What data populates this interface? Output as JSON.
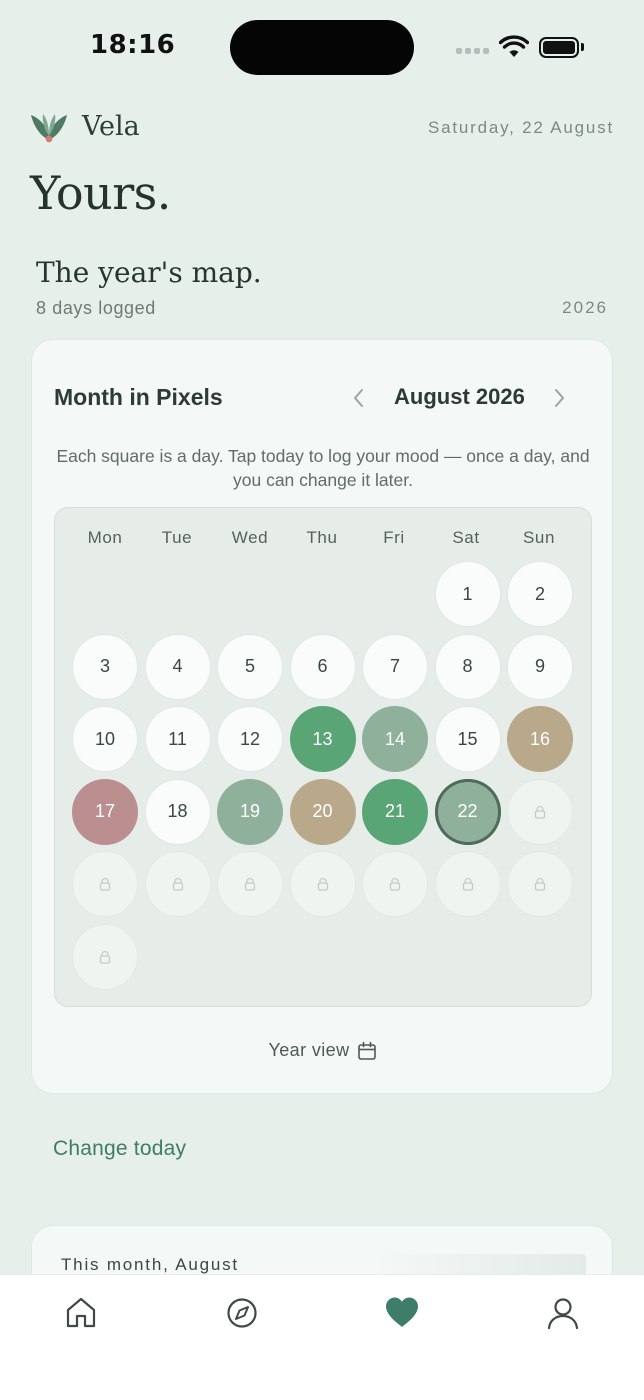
{
  "status": {
    "time": "18:16"
  },
  "header": {
    "brand": "Vela",
    "date": "Saturday, 22 August",
    "title": "Yours."
  },
  "section": {
    "title": "The year's map.",
    "days_logged": "8 days logged",
    "year": "2026"
  },
  "calendar": {
    "title": "Month in Pixels",
    "month": "August 2026",
    "helper": "Each square is a day. Tap today to log your mood — once a day, and you can change it later.",
    "weekdays": [
      "Mon",
      "Tue",
      "Wed",
      "Thu",
      "Fri",
      "Sat",
      "Sun"
    ],
    "first_weekday_index": 5,
    "today": 22,
    "last_unlocked_day": 22,
    "days_in_month": 31,
    "mood_days": {
      "13": "#5aa576",
      "14": "#8fb19b",
      "16": "#b9a88a",
      "17": "#bb8f8f",
      "19": "#8fb19b",
      "20": "#b9a88a",
      "21": "#5aa576",
      "22": "#8fb19b"
    },
    "year_view_label": "Year view"
  },
  "change_today_label": "Change today",
  "month_card": {
    "title": "This month, August"
  },
  "tabs": [
    {
      "name": "home",
      "icon": "home-icon"
    },
    {
      "name": "explore",
      "icon": "compass-icon"
    },
    {
      "name": "yours",
      "icon": "heart-icon",
      "active": true
    },
    {
      "name": "profile",
      "icon": "user-icon"
    }
  ],
  "colors": {
    "accent": "#3f7d63",
    "active_tab": "#3e7d69",
    "background": "#e7efea"
  }
}
